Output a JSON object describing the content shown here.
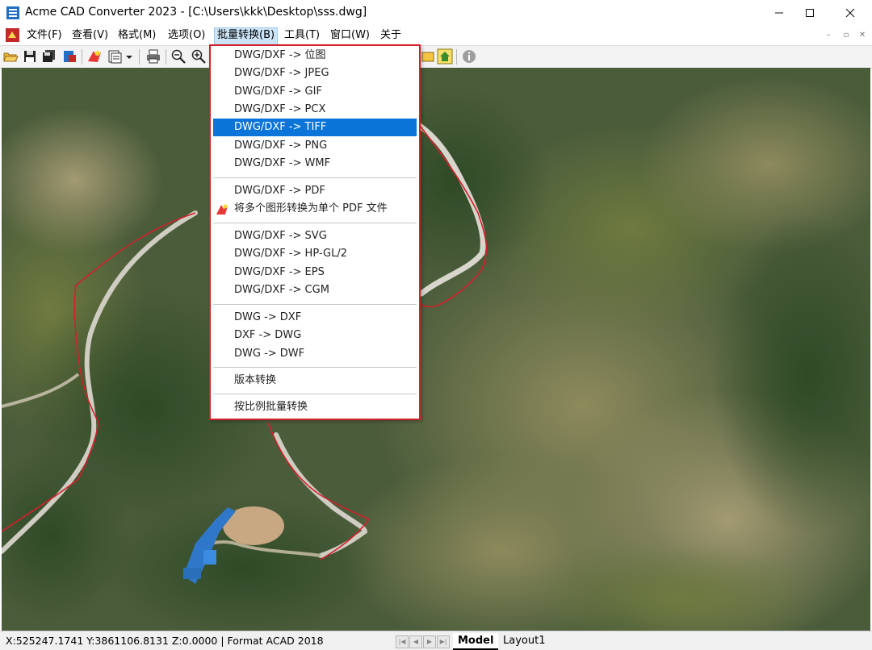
{
  "window": {
    "title": "Acme CAD Converter 2023 - [C:\\Users\\kkk\\Desktop\\sss.dwg]"
  },
  "menubar": {
    "items": [
      {
        "label": "文件(F)"
      },
      {
        "label": "查看(V)"
      },
      {
        "label": "格式(M)"
      },
      {
        "label": "选项(O)"
      },
      {
        "label": "批量转换(B)",
        "active": true
      },
      {
        "label": "工具(T)"
      },
      {
        "label": "窗口(W)"
      },
      {
        "label": "关于"
      }
    ]
  },
  "dropdown": {
    "items": [
      {
        "label": "DWG/DXF -> 位图"
      },
      {
        "label": "DWG/DXF -> JPEG"
      },
      {
        "label": "DWG/DXF -> GIF"
      },
      {
        "label": "DWG/DXF -> PCX"
      },
      {
        "label": "DWG/DXF -> TIFF",
        "highlighted": true
      },
      {
        "label": "DWG/DXF -> PNG"
      },
      {
        "label": "DWG/DXF -> WMF"
      },
      {
        "label": "DWG/DXF -> PDF"
      },
      {
        "label": "将多个图形转换为单个 PDF 文件",
        "icon": "pdf-merge-icon"
      },
      {
        "label": "DWG/DXF -> SVG"
      },
      {
        "label": "DWG/DXF -> HP-GL/2"
      },
      {
        "label": "DWG/DXF -> EPS"
      },
      {
        "label": "DWG/DXF -> CGM"
      },
      {
        "label": "DWG -> DXF"
      },
      {
        "label": "DXF -> DWG"
      },
      {
        "label": "DWG -> DWF"
      },
      {
        "label": "版本转换"
      },
      {
        "label": "按比例批量转换"
      }
    ]
  },
  "statusbar": {
    "coords": "X:525247.1741 Y:3861106.8131 Z:0.0000 | Format ACAD 2018",
    "tabs": [
      {
        "label": "Model",
        "active": true
      },
      {
        "label": "Layout1"
      }
    ]
  },
  "colors": {
    "highlight": "#0a74d8",
    "annotation_border": "#d4202c",
    "boundary_line": "#d4202c"
  },
  "icons": {
    "app": "acme-cad-icon",
    "toolbar": [
      "open-folder-icon",
      "save-icon",
      "save-all-icon",
      "export-icon",
      "convert-icon",
      "batch-icon",
      "dropdown-arrow-icon",
      "print-icon",
      "zoom-out-icon",
      "zoom-in-icon",
      "home-icon",
      "info-icon"
    ]
  }
}
